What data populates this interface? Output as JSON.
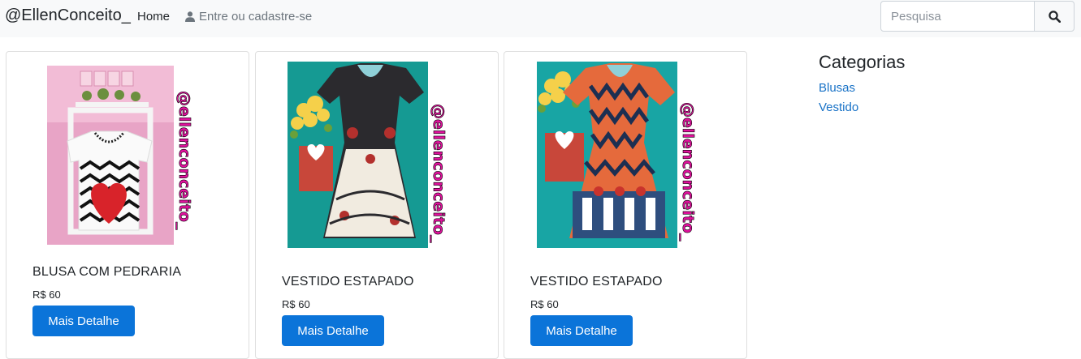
{
  "navbar": {
    "brand": "@EllenConceito_",
    "home": "Home",
    "login": "Entre ou cadastre-se",
    "search_placeholder": "Pesquisa"
  },
  "products": [
    {
      "title": "BLUSA COM PEDRARIA",
      "price": "R$ 60",
      "button": "Mais Detalhe",
      "watermark": "@ellenconceito_"
    },
    {
      "title": "VESTIDO ESTAPADO",
      "price": "R$ 60",
      "button": "Mais Detalhe",
      "watermark": "@ellenconceito_"
    },
    {
      "title": "VESTIDO ESTAPADO",
      "price": "R$ 60",
      "button": "Mais Detalhe",
      "watermark": "@ellenconceito_"
    }
  ],
  "sidebar": {
    "title": "Categorias",
    "categories": [
      "Blusas",
      "Vestido"
    ]
  },
  "colors": {
    "button": "#0b74d9",
    "link": "#1a73c7",
    "watermark": "#e0119d"
  }
}
